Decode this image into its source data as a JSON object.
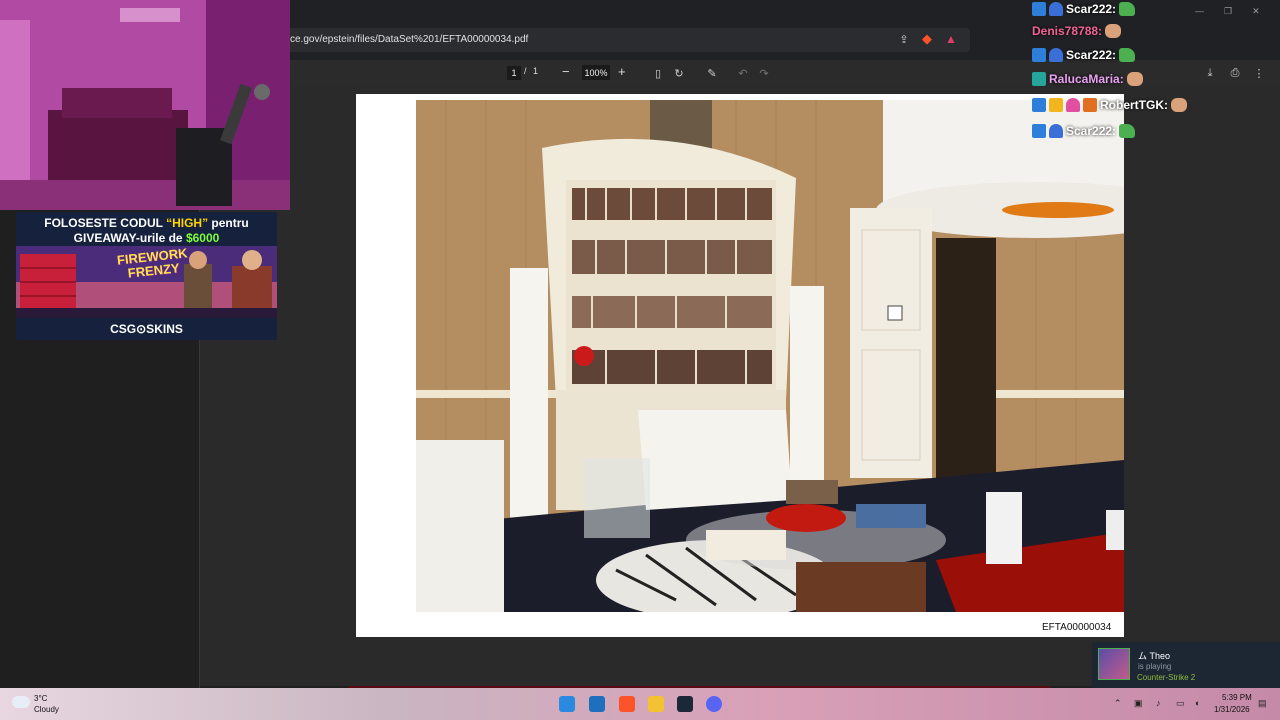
{
  "browser": {
    "url": "ce.gov/epstein/files/DataSet%201/EFTA00000034.pdf",
    "window_controls": [
      "—",
      "❐",
      "✕"
    ]
  },
  "pdf_toolbar": {
    "page_current": "1",
    "page_separator": "/",
    "page_total": "1",
    "zoom_out": "−",
    "zoom": "100%",
    "zoom_in": "+"
  },
  "document": {
    "id_label": "EFTA00000034"
  },
  "promo": {
    "line1_prefix": "FOLOSESTE CODUL ",
    "line1_code": "“HIGH”",
    "line1_suffix": " pentru",
    "line2_prefix": "GIVEAWAY-urile de ",
    "line2_amount": "$6000",
    "game_title": "FIREWORK FRENZY",
    "footer": "CSG⊙SKINS"
  },
  "chat": [
    {
      "name": "Scar222:",
      "badges": [
        "b-blue",
        "b-ghost"
      ],
      "name_class": "name-scar",
      "emote": "emote-pepe"
    },
    {
      "name": "Denis78788:",
      "badges": [],
      "name_class": "name-denis",
      "emote": "emote-hand"
    },
    {
      "name": "Scar222:",
      "badges": [
        "b-blue",
        "b-ghost"
      ],
      "name_class": "name-scar",
      "emote": "emote-pepe"
    },
    {
      "name": "RalucaMaria:",
      "badges": [
        "b-teal"
      ],
      "name_class": "name-raluca",
      "emote": "emote-hand"
    },
    {
      "name": "RobertTGK:",
      "badges": [
        "b-blue",
        "b-yellow",
        "b-pink",
        "b-orange"
      ],
      "name_class": "name-robert",
      "emote": "emote-hand"
    },
    {
      "name": "Scar222:",
      "badges": [
        "b-blue",
        "b-ghost"
      ],
      "name_class": "name-scar",
      "emote": "emote-pepe"
    }
  ],
  "steam": {
    "name": "ム Theo",
    "status": "is playing",
    "game": "Counter-Strike 2"
  },
  "taskbar": {
    "temp": "3°C",
    "condition": "Cloudy",
    "time": "5:39 PM",
    "date": "1/31/2026"
  }
}
